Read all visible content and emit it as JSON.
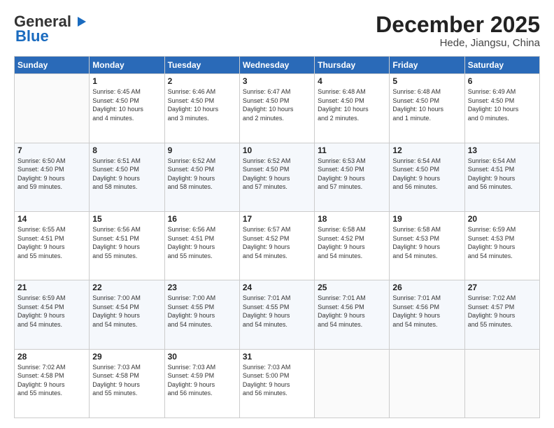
{
  "header": {
    "logo_general": "General",
    "logo_blue": "Blue",
    "month": "December 2025",
    "location": "Hede, Jiangsu, China"
  },
  "weekdays": [
    "Sunday",
    "Monday",
    "Tuesday",
    "Wednesday",
    "Thursday",
    "Friday",
    "Saturday"
  ],
  "weeks": [
    [
      {
        "day": "",
        "info": ""
      },
      {
        "day": "1",
        "info": "Sunrise: 6:45 AM\nSunset: 4:50 PM\nDaylight: 10 hours\nand 4 minutes."
      },
      {
        "day": "2",
        "info": "Sunrise: 6:46 AM\nSunset: 4:50 PM\nDaylight: 10 hours\nand 3 minutes."
      },
      {
        "day": "3",
        "info": "Sunrise: 6:47 AM\nSunset: 4:50 PM\nDaylight: 10 hours\nand 2 minutes."
      },
      {
        "day": "4",
        "info": "Sunrise: 6:48 AM\nSunset: 4:50 PM\nDaylight: 10 hours\nand 2 minutes."
      },
      {
        "day": "5",
        "info": "Sunrise: 6:48 AM\nSunset: 4:50 PM\nDaylight: 10 hours\nand 1 minute."
      },
      {
        "day": "6",
        "info": "Sunrise: 6:49 AM\nSunset: 4:50 PM\nDaylight: 10 hours\nand 0 minutes."
      }
    ],
    [
      {
        "day": "7",
        "info": "Sunrise: 6:50 AM\nSunset: 4:50 PM\nDaylight: 9 hours\nand 59 minutes."
      },
      {
        "day": "8",
        "info": "Sunrise: 6:51 AM\nSunset: 4:50 PM\nDaylight: 9 hours\nand 58 minutes."
      },
      {
        "day": "9",
        "info": "Sunrise: 6:52 AM\nSunset: 4:50 PM\nDaylight: 9 hours\nand 58 minutes."
      },
      {
        "day": "10",
        "info": "Sunrise: 6:52 AM\nSunset: 4:50 PM\nDaylight: 9 hours\nand 57 minutes."
      },
      {
        "day": "11",
        "info": "Sunrise: 6:53 AM\nSunset: 4:50 PM\nDaylight: 9 hours\nand 57 minutes."
      },
      {
        "day": "12",
        "info": "Sunrise: 6:54 AM\nSunset: 4:50 PM\nDaylight: 9 hours\nand 56 minutes."
      },
      {
        "day": "13",
        "info": "Sunrise: 6:54 AM\nSunset: 4:51 PM\nDaylight: 9 hours\nand 56 minutes."
      }
    ],
    [
      {
        "day": "14",
        "info": "Sunrise: 6:55 AM\nSunset: 4:51 PM\nDaylight: 9 hours\nand 55 minutes."
      },
      {
        "day": "15",
        "info": "Sunrise: 6:56 AM\nSunset: 4:51 PM\nDaylight: 9 hours\nand 55 minutes."
      },
      {
        "day": "16",
        "info": "Sunrise: 6:56 AM\nSunset: 4:51 PM\nDaylight: 9 hours\nand 55 minutes."
      },
      {
        "day": "17",
        "info": "Sunrise: 6:57 AM\nSunset: 4:52 PM\nDaylight: 9 hours\nand 54 minutes."
      },
      {
        "day": "18",
        "info": "Sunrise: 6:58 AM\nSunset: 4:52 PM\nDaylight: 9 hours\nand 54 minutes."
      },
      {
        "day": "19",
        "info": "Sunrise: 6:58 AM\nSunset: 4:53 PM\nDaylight: 9 hours\nand 54 minutes."
      },
      {
        "day": "20",
        "info": "Sunrise: 6:59 AM\nSunset: 4:53 PM\nDaylight: 9 hours\nand 54 minutes."
      }
    ],
    [
      {
        "day": "21",
        "info": "Sunrise: 6:59 AM\nSunset: 4:54 PM\nDaylight: 9 hours\nand 54 minutes."
      },
      {
        "day": "22",
        "info": "Sunrise: 7:00 AM\nSunset: 4:54 PM\nDaylight: 9 hours\nand 54 minutes."
      },
      {
        "day": "23",
        "info": "Sunrise: 7:00 AM\nSunset: 4:55 PM\nDaylight: 9 hours\nand 54 minutes."
      },
      {
        "day": "24",
        "info": "Sunrise: 7:01 AM\nSunset: 4:55 PM\nDaylight: 9 hours\nand 54 minutes."
      },
      {
        "day": "25",
        "info": "Sunrise: 7:01 AM\nSunset: 4:56 PM\nDaylight: 9 hours\nand 54 minutes."
      },
      {
        "day": "26",
        "info": "Sunrise: 7:01 AM\nSunset: 4:56 PM\nDaylight: 9 hours\nand 54 minutes."
      },
      {
        "day": "27",
        "info": "Sunrise: 7:02 AM\nSunset: 4:57 PM\nDaylight: 9 hours\nand 55 minutes."
      }
    ],
    [
      {
        "day": "28",
        "info": "Sunrise: 7:02 AM\nSunset: 4:58 PM\nDaylight: 9 hours\nand 55 minutes."
      },
      {
        "day": "29",
        "info": "Sunrise: 7:03 AM\nSunset: 4:58 PM\nDaylight: 9 hours\nand 55 minutes."
      },
      {
        "day": "30",
        "info": "Sunrise: 7:03 AM\nSunset: 4:59 PM\nDaylight: 9 hours\nand 56 minutes."
      },
      {
        "day": "31",
        "info": "Sunrise: 7:03 AM\nSunset: 5:00 PM\nDaylight: 9 hours\nand 56 minutes."
      },
      {
        "day": "",
        "info": ""
      },
      {
        "day": "",
        "info": ""
      },
      {
        "day": "",
        "info": ""
      }
    ]
  ]
}
